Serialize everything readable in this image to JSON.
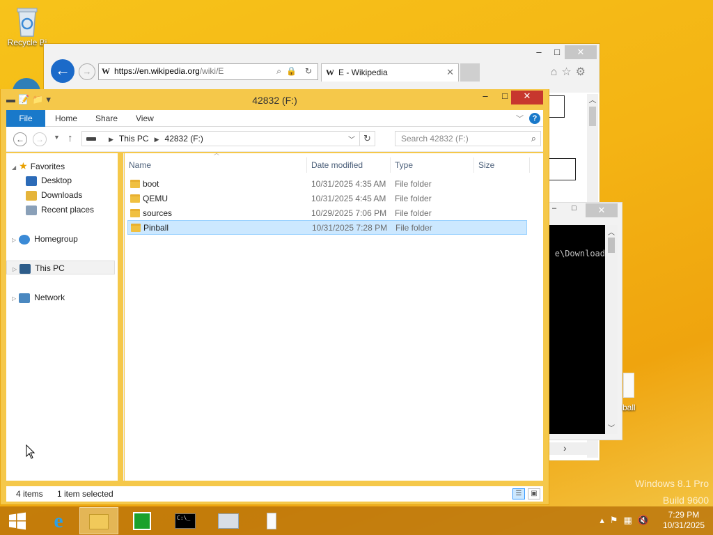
{
  "desktop": {
    "recycle_bin_label": "Recycle Bi",
    "ball_label": "ball",
    "watermark_line1": "Windows 8.1 Pro",
    "watermark_line2": "Build 9600"
  },
  "browser": {
    "address_host": "https://en.wikipedia.org",
    "address_path": "/wiki/E",
    "tab_title": "E - Wikipedia",
    "wiki_glyph": "W",
    "minimize": "–",
    "maximize": "□",
    "close": "✕"
  },
  "cmd": {
    "visible_text": "e\\Download"
  },
  "explorer": {
    "title": "42832 (F:)",
    "ribbon_tabs": [
      "File",
      "Home",
      "Share",
      "View"
    ],
    "breadcrumb": [
      "This PC",
      "42832 (F:)"
    ],
    "search_placeholder": "Search 42832 (F:)",
    "nav_tree": {
      "favorites": "Favorites",
      "desktop": "Desktop",
      "downloads": "Downloads",
      "recent_places": "Recent places",
      "homegroup": "Homegroup",
      "this_pc": "This PC",
      "network": "Network"
    },
    "columns": [
      "Name",
      "Date modified",
      "Type",
      "Size"
    ],
    "rows": [
      {
        "name": "boot",
        "date": "10/31/2025 4:35 AM",
        "type": "File folder",
        "selected": false
      },
      {
        "name": "QEMU",
        "date": "10/31/2025 4:45 AM",
        "type": "File folder",
        "selected": false
      },
      {
        "name": "sources",
        "date": "10/29/2025 7:06 PM",
        "type": "File folder",
        "selected": false
      },
      {
        "name": "Pinball",
        "date": "10/31/2025 7:28 PM",
        "type": "File folder",
        "selected": true
      }
    ],
    "status_items": "4 items",
    "status_selected": "1 item selected"
  },
  "taskbar": {
    "time": "7:29 PM",
    "date": "10/31/2025",
    "cmd_icon_text": "C:\\_"
  },
  "colors": {
    "accent": "#1979ca",
    "selection": "#cce8ff",
    "frame": "#f5c84a",
    "close_red": "#c7372e"
  }
}
